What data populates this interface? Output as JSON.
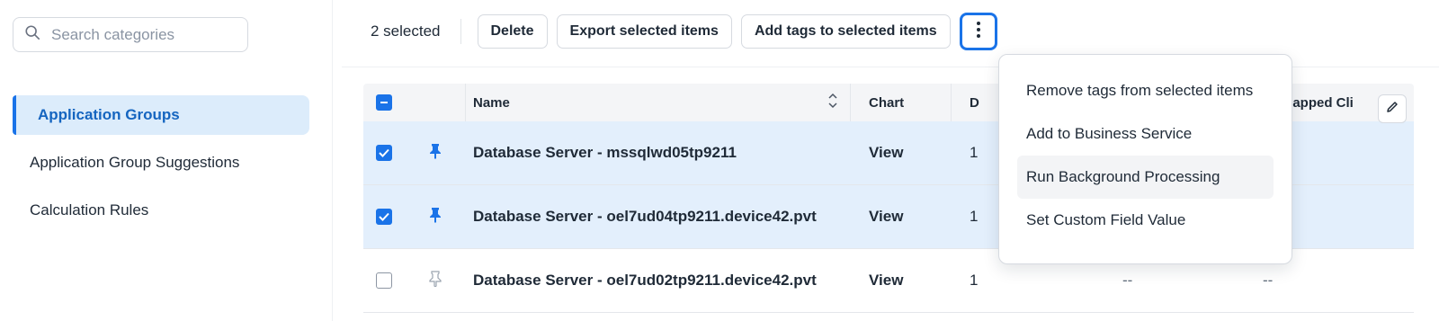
{
  "sidebar": {
    "search_placeholder": "Search categories",
    "items": [
      {
        "label": "Application Groups",
        "active": true
      },
      {
        "label": "Application Group Suggestions",
        "active": false
      },
      {
        "label": "Calculation Rules",
        "active": false
      }
    ]
  },
  "toolbar": {
    "selected_text": "2 selected",
    "delete_label": "Delete",
    "export_label": "Export selected items",
    "add_tags_label": "Add tags to selected items",
    "more_icon": "kebab-vertical-icon"
  },
  "menu": {
    "items": [
      "Remove tags from selected items",
      "Add to Business Service",
      "Run Background Processing",
      "Set Custom Field Value"
    ],
    "hovered_index": 2
  },
  "table": {
    "headers": {
      "name": "Name",
      "chart": "Chart",
      "d": "D",
      "unmapped": "Unmapped Cli"
    },
    "rows": [
      {
        "name": "Database Server - mssqlwd05tp9211",
        "chart": "View",
        "d": "1",
        "x": "",
        "unm": "--",
        "selected": true,
        "pinned": true
      },
      {
        "name": "Database Server - oel7ud04tp9211.device42.pvt",
        "chart": "View",
        "d": "1",
        "x": "",
        "unm": "--",
        "selected": true,
        "pinned": true
      },
      {
        "name": "Database Server - oel7ud02tp9211.device42.pvt",
        "chart": "View",
        "d": "1",
        "x": "--",
        "unm": "--",
        "selected": false,
        "pinned": false
      }
    ]
  },
  "colors": {
    "accent": "#1a73e8",
    "selected_row": "#e3effc",
    "active_nav": "#dcecfb"
  }
}
